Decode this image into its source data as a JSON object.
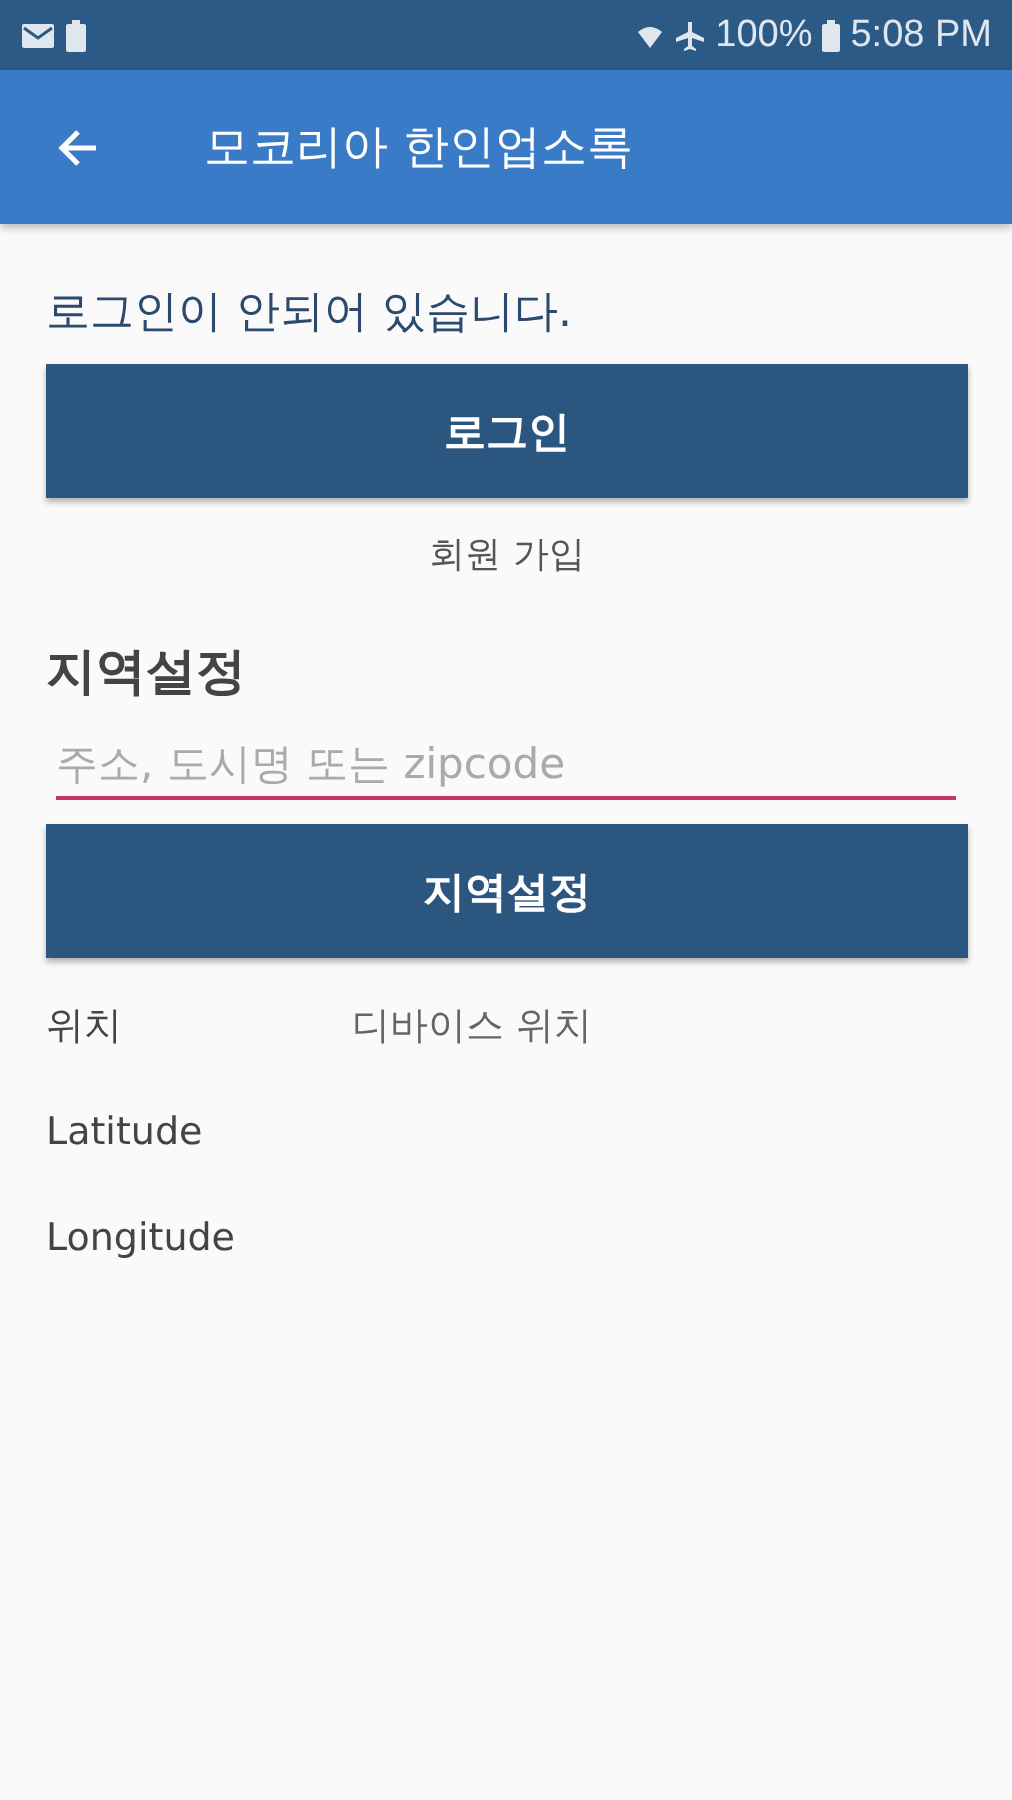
{
  "status_bar": {
    "battery": "100%",
    "time": "5:08 PM"
  },
  "app_bar": {
    "title": "모코리아 한인업소록"
  },
  "login": {
    "message": "로그인이 안되어 있습니다.",
    "button": "로그인",
    "signup_link": "회원 가입"
  },
  "region": {
    "heading": "지역설정",
    "search": {
      "placeholder": "주소, 도시명 또는 zipcode"
    },
    "button": "지역설정"
  },
  "info_rows": [
    {
      "label": "위치",
      "value": "디바이스 위치"
    },
    {
      "label": "Latitude"
    },
    {
      "label": "Longitude"
    }
  ]
}
